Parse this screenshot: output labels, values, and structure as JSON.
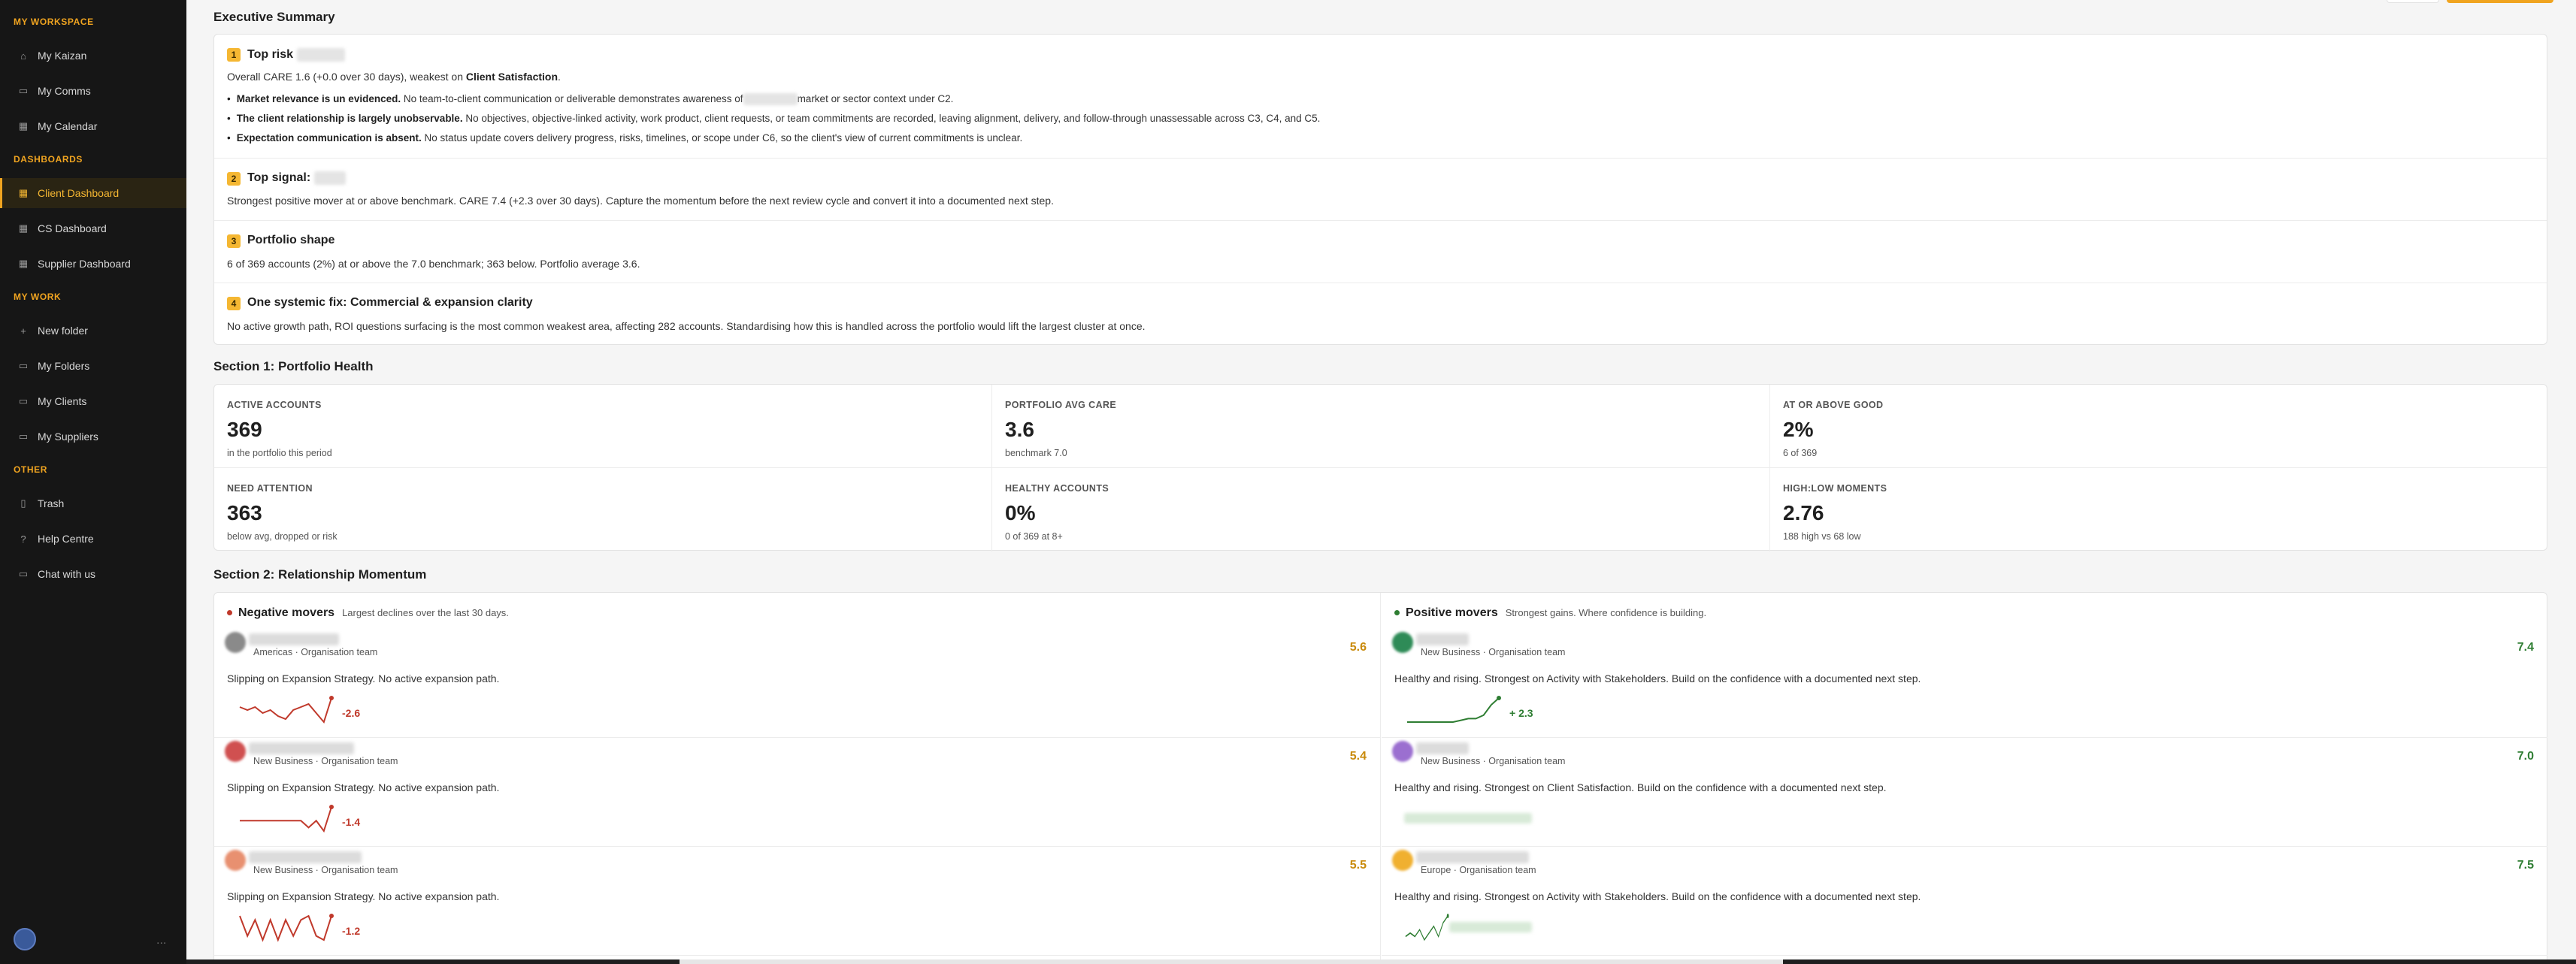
{
  "sidebar": {
    "sections": [
      {
        "title": "MY WORKSPACE",
        "items": [
          {
            "label": "My Kaizan",
            "icon": "home-icon"
          },
          {
            "label": "My Comms",
            "icon": "chat-icon"
          },
          {
            "label": "My Calendar",
            "icon": "calendar-icon"
          }
        ]
      },
      {
        "title": "DASHBOARDS",
        "items": [
          {
            "label": "Client Dashboard",
            "icon": "grid-icon"
          },
          {
            "label": "CS Dashboard",
            "icon": "grid-icon"
          },
          {
            "label": "Supplier Dashboard",
            "icon": "grid-icon"
          }
        ]
      },
      {
        "title": "MY WORK",
        "items": [
          {
            "label": "New folder",
            "icon": "plus-icon"
          },
          {
            "label": "My Folders",
            "icon": "folder-icon"
          },
          {
            "label": "My Clients",
            "icon": "folder-icon"
          },
          {
            "label": "My Suppliers",
            "icon": "folder-icon"
          }
        ]
      },
      {
        "title": "OTHER",
        "items": [
          {
            "label": "Trash",
            "icon": "trash-icon"
          },
          {
            "label": "Help Centre",
            "icon": "help-icon"
          },
          {
            "label": "Chat with us",
            "icon": "message-icon"
          }
        ]
      }
    ],
    "active": "Client Dashboard",
    "more": "..."
  },
  "exec": {
    "title": "Executive Summary",
    "blocks": {
      "b1": {
        "num": "1",
        "heading": "Top risk",
        "line_prefix": "Overall CARE 1.6 (+0.0 over 30 days), weakest on ",
        "line_bold": "Client Satisfaction",
        "line_suffix": ".",
        "bullets": [
          {
            "bold": "Market relevance is un evidenced.",
            "text_a": " No team-to-client communication or deliverable demonstrates awareness of",
            "text_b": "market or sector context under C2."
          },
          {
            "bold": "The client relationship is largely unobservable.",
            "text_a": " No objectives, objective-linked activity, work product, client requests, or team commitments are recorded, leaving alignment, delivery, and follow-through unassessable across C3, C4, and C5.",
            "text_b": ""
          },
          {
            "bold": "Expectation communication is absent.",
            "text_a": " No status update covers delivery progress, risks, timelines, or scope under C6, so the client's view of current commitments is unclear.",
            "text_b": ""
          }
        ]
      },
      "b2": {
        "num": "2",
        "heading": "Top signal:",
        "line": "Strongest positive mover at or above benchmark. CARE 7.4 (+2.3 over 30 days). Capture the momentum before the next review cycle and convert it into a documented next step."
      },
      "b3": {
        "num": "3",
        "heading": "Portfolio shape",
        "line": "6 of 369 accounts (2%) at or above the 7.0 benchmark; 363 below. Portfolio average 3.6."
      },
      "b4": {
        "num": "4",
        "heading": "One systemic fix: Commercial & expansion clarity",
        "line": "No active growth path, ROI questions surfacing is the most common weakest area, affecting 282 accounts. Standardising how this is handled across the portfolio would lift the largest cluster at once."
      }
    }
  },
  "health": {
    "title": "Section 1: Portfolio Health",
    "stats": [
      {
        "label": "ACTIVE ACCOUNTS",
        "value": "369",
        "sub": "in the portfolio this period"
      },
      {
        "label": "PORTFOLIO AVG CARE",
        "value": "3.6",
        "sub": "benchmark 7.0"
      },
      {
        "label": "AT OR ABOVE GOOD",
        "value": "2%",
        "sub": "6 of 369"
      },
      {
        "label": "NEED ATTENTION",
        "value": "363",
        "sub": "below avg, dropped or risk"
      },
      {
        "label": "HEALTHY ACCOUNTS",
        "value": "0%",
        "sub": "0 of 369 at 8+"
      },
      {
        "label": "HIGH:LOW MOMENTS",
        "value": "2.76",
        "sub": "188 high vs 68 low"
      }
    ]
  },
  "momentum": {
    "title": "Section 2: Relationship Momentum",
    "negative": {
      "heading": "Negative movers",
      "sub": "Largest declines over the last 30 days.",
      "color": "#c0392b",
      "items": [
        {
          "meta": "Americas · Organisation team",
          "score": "5.6",
          "desc": "Slipping on Expansion Strategy. No active expansion path.",
          "delta": "-2.6",
          "trend": [
            5,
            4,
            5,
            3,
            4,
            2,
            1,
            4,
            5,
            6,
            3,
            0,
            8
          ]
        },
        {
          "meta": "New Business · Organisation team",
          "score": "5.4",
          "desc": "Slipping on Expansion Strategy. No active expansion path.",
          "delta": "-1.4",
          "trend": [
            3,
            3,
            3,
            3,
            3,
            3,
            3,
            3,
            3,
            1,
            3,
            0,
            7
          ]
        },
        {
          "meta": "New Business · Organisation team",
          "score": "5.5",
          "desc": "Slipping on Expansion Strategy. No active expansion path.",
          "delta": "-1.2",
          "trend": [
            7,
            2,
            6,
            1,
            6,
            1,
            6,
            2,
            6,
            7,
            2,
            1,
            7
          ]
        }
      ]
    },
    "positive": {
      "heading": "Positive movers",
      "sub": "Strongest gains. Where confidence is building.",
      "color": "#2e7d32",
      "items": [
        {
          "meta": "New Business · Organisation team",
          "score": "7.4",
          "desc": "Healthy and rising. Strongest on Activity with Stakeholders. Build on the confidence with a documented next step.",
          "delta": "+ 2.3",
          "trend": [
            1,
            1,
            1,
            1,
            1,
            1,
            1,
            1.5,
            2,
            2,
            3,
            6,
            8
          ]
        },
        {
          "meta": "New Business · Organisation team",
          "score": "7.0",
          "desc": "Healthy and rising. Strongest on Client Satisfaction. Build on the confidence with a documented next step.",
          "delta": "",
          "trend": []
        },
        {
          "meta": "Europe · Organisation team",
          "score": "7.5",
          "desc": "Healthy and rising. Strongest on Activity with Stakeholders. Build on the confidence with a documented next step.",
          "delta": "",
          "trend": [
            2,
            3,
            2,
            4,
            1,
            3,
            5,
            2,
            6,
            8
          ]
        }
      ]
    }
  },
  "colors": {
    "accent": "#f0a420",
    "score_amber": "#c98a0a",
    "score_green": "#2e7d32",
    "negative_red": "#c0392b"
  }
}
